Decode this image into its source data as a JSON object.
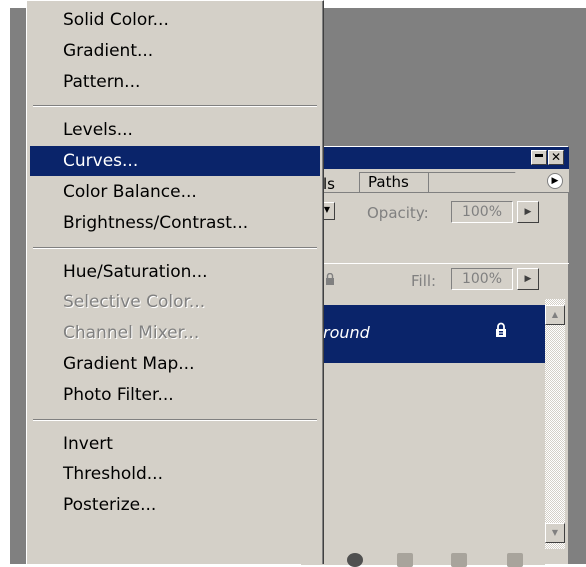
{
  "layers_panel": {
    "tab_channels": "ls",
    "tab_paths": "Paths",
    "opacity_label": "Opacity:",
    "opacity_value": "100%",
    "fill_label": "Fill:",
    "fill_value": "100%",
    "layer_name": "round"
  },
  "menu": {
    "groups": [
      [
        "Solid Color...",
        "Gradient...",
        "Pattern..."
      ],
      [
        "Levels...",
        "Curves...",
        "Color Balance...",
        "Brightness/Contrast..."
      ],
      [
        "Hue/Saturation...",
        "Selective Color...",
        "Channel Mixer...",
        "Gradient Map...",
        "Photo Filter..."
      ],
      [
        "Invert",
        "Threshold...",
        "Posterize..."
      ]
    ],
    "selected_item": "Curves...",
    "disabled_items": [
      "Selective Color...",
      "Channel Mixer..."
    ]
  },
  "icons": {
    "panel_minimize": "minimize-icon",
    "panel_close": "close-icon",
    "panel_menu": "panel-menu-arrow-icon",
    "layer_lock": "lock-icon",
    "scroll_up": "arrow-up-icon",
    "scroll_down": "arrow-down-icon"
  },
  "colors": {
    "highlight": "#0a246a",
    "menu_background": "#d4d0c8",
    "workspace": "#808080"
  }
}
